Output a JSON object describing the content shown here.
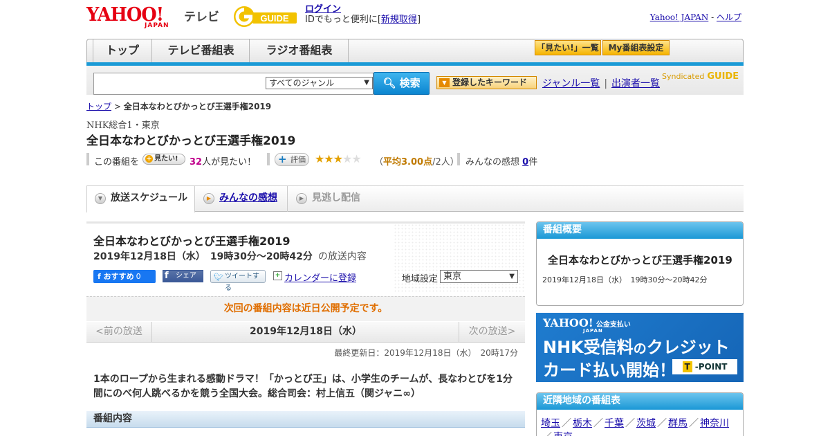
{
  "header": {
    "logo_text": "YAHOO!",
    "logo_sub": "JAPAN",
    "service": "テレビ",
    "gguide": "GUIDE",
    "login": "ログイン",
    "login_prefix": "IDでもっと便利に[",
    "signup": "新規取得",
    "login_suffix": "]",
    "yahoo_japan": "Yahoo! JAPAN",
    "sep": " - ",
    "help": "ヘルプ"
  },
  "nav": {
    "tabs": [
      "トップ",
      "テレビ番組表",
      "ラジオ番組表"
    ],
    "buttons": [
      "「見たい!」一覧",
      "My番組表設定"
    ]
  },
  "search": {
    "placeholder": "",
    "genre": "すべてのジャンル",
    "button": "検索",
    "keyword_button": "登録したキーワード",
    "links": [
      "ジャンル一覧",
      "出演者一覧"
    ],
    "syndicated": "Syndicated",
    "syndicated_logo": "GUIDE"
  },
  "breadcrumb": {
    "top": "トップ",
    "sep": ">",
    "current": "全日本なわとびかっとび王選手権2019"
  },
  "program": {
    "channel": "NHK総合1・東京",
    "title": "全日本なわとびかっとび王選手権2019",
    "mitai_label": "この番組を",
    "mitai_button": "見たい!",
    "mitai_count": "32",
    "mitai_suffix": "人が見たい！",
    "rate_button": "評価",
    "rating": 3,
    "rating_max": 5,
    "avg_open": "（",
    "avg_label": "平均3.00点",
    "avg_people": "/2人）",
    "kansou_label": "みんなの感想",
    "kansou_count": "0",
    "kansou_suffix": "件"
  },
  "tabs": [
    "放送スケジュール",
    "みんなの感想",
    "見逃し配信"
  ],
  "schedule": {
    "title": "全日本なわとびかっとび王選手権2019",
    "date": "2019年12月18日（水）　19時30分～20時42分",
    "date_suffix": "の放送内容",
    "fb_label": "おすすめ",
    "fb_count": "0",
    "share": "シェア",
    "tweet": "ツイートする",
    "calendar": "カレンダーに登録",
    "region_label": "地域設定",
    "region": "東京",
    "next_note": "次回の番組内容は近日公開予定です。",
    "prev": "<前の放送",
    "pager_date": "2019年12月18日（水）",
    "next": "次の放送>",
    "updated": "最終更新日：2019年12月18日（水）　20時17分",
    "description": "1本のロープから生まれる感動ドラマ！「かっとび王」は、小学生のチームが、長なわとびを1分間にのべ何人跳べるかを競う全国大会。総合司会：村上信五（関ジャニ∞）",
    "section": "番組内容"
  },
  "sidebar": {
    "overview_head": "番組概要",
    "overview_title": "全日本なわとびかっとび王選手権2019",
    "overview_date": "2019年12月18日（水）　19時30分～20時42分",
    "ad_logo": "YAHOO!",
    "ad_logo_jp": "JAPAN",
    "ad_pay": "公金支払い",
    "ad_line1_a": "NHK受信料",
    "ad_line1_b": "の",
    "ad_line1_c": "クレジット",
    "ad_line2": "カード払い開始！",
    "ad_tpoint_t": "T",
    "ad_tpoint": "-POINT",
    "nearby_head": "近隣地域の番組表",
    "nearby": [
      "埼玉",
      "栃木",
      "千葉",
      "茨城",
      "群馬",
      "神奈川",
      "東京"
    ],
    "nearby_sep": "／"
  },
  "colors": {
    "accent_blue": "#1a98d6",
    "brand_red": "#e60012",
    "orange": "#e06e00"
  }
}
